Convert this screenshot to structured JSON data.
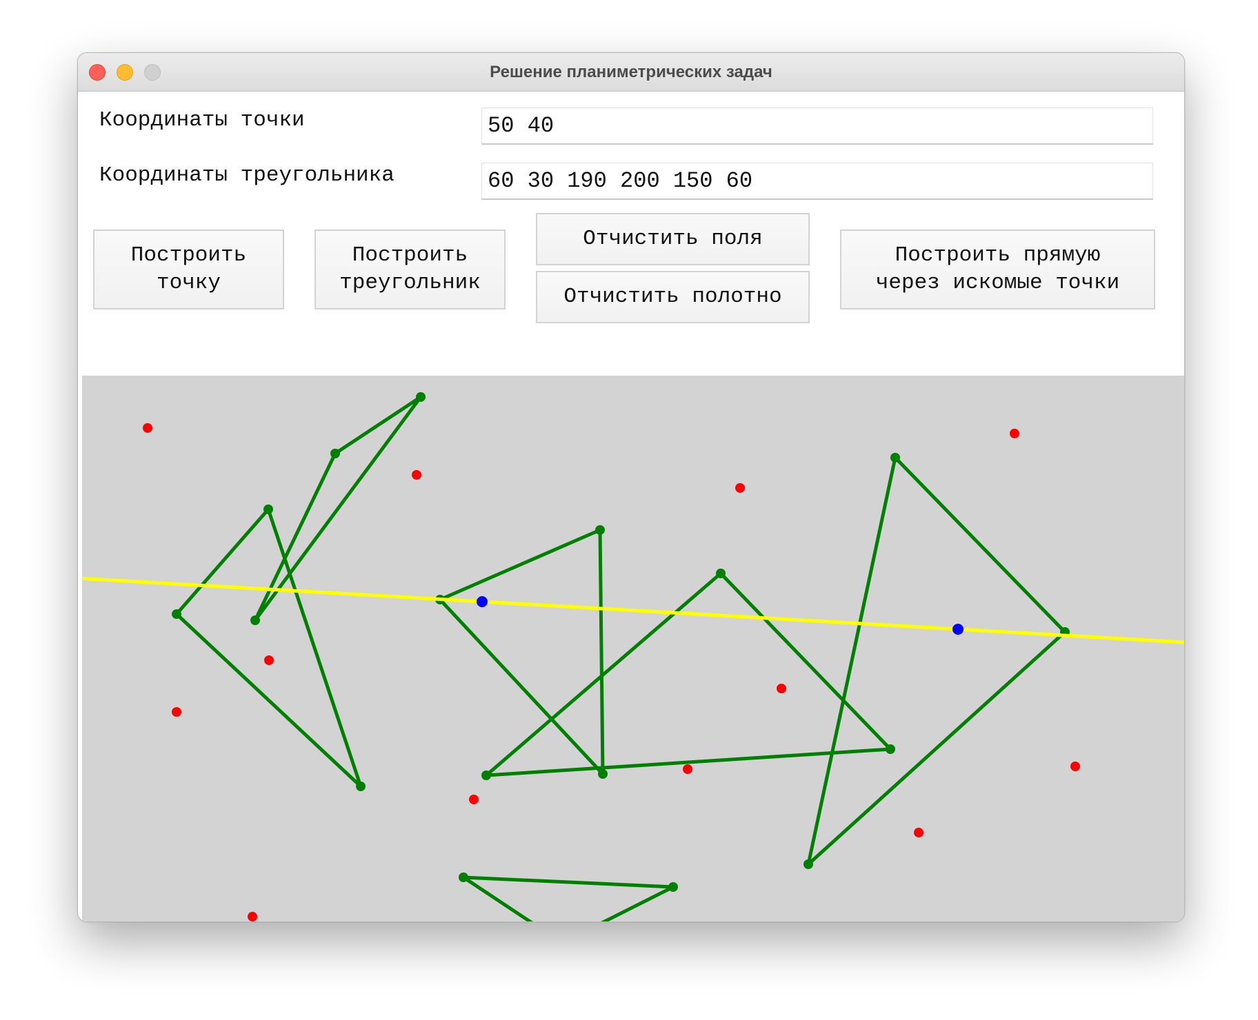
{
  "window": {
    "title": "Решение планиметрических задач"
  },
  "form": {
    "point_label": "Координаты точки",
    "point_value": "50 40",
    "triangle_label": "Координаты треугольника",
    "triangle_value": "60 30 190 200 150 60"
  },
  "buttons": {
    "build_point": "Построить\nточку",
    "build_triangle": "Построить\nтреугольник",
    "clear_fields": "Отчистить поля",
    "clear_canvas": "Отчистить полотно",
    "build_line": "Построить прямую\nчерез искомые точки"
  },
  "colors": {
    "canvas_bg": "#d3d3d3",
    "triangle": "#008000",
    "point": "#ff0000",
    "selected_point": "#0000ff",
    "line": "#ffff00"
  }
}
